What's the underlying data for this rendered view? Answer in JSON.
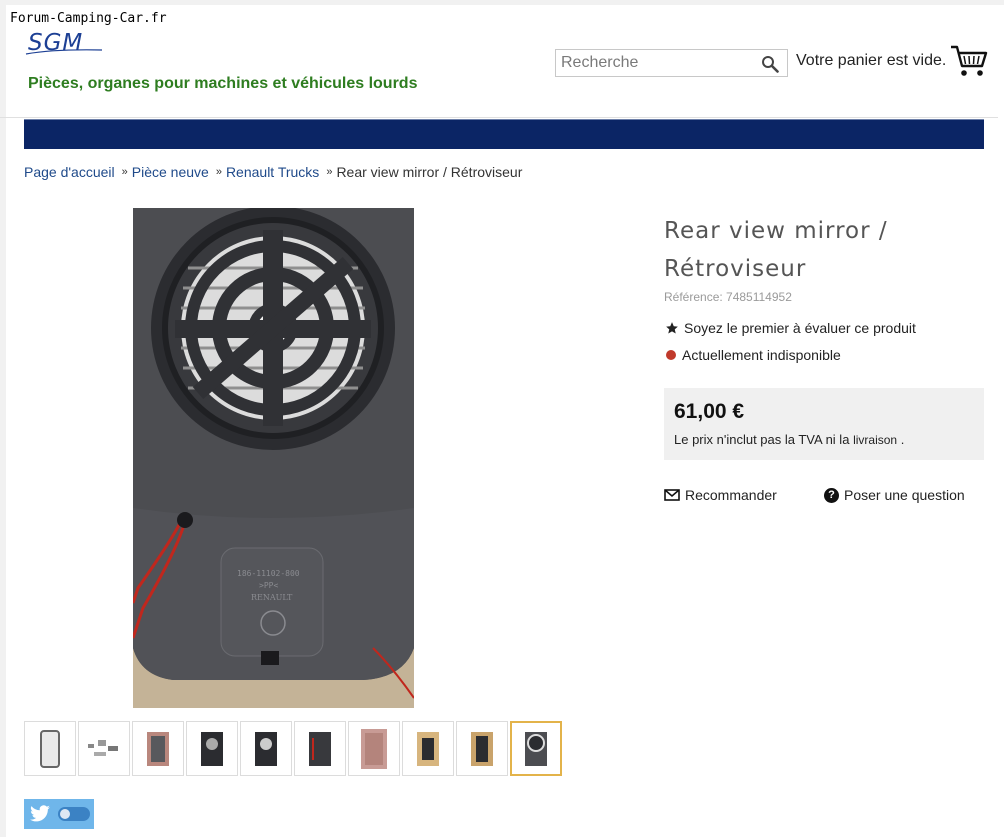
{
  "forum_banner": "Forum-Camping-Car.fr",
  "header": {
    "logo_text": "SGM",
    "tagline": "Pièces, organes pour machines et véhicules lourds",
    "search_placeholder": "Recherche",
    "cart_text": "Votre panier est vide."
  },
  "breadcrumb": {
    "items": [
      "Page d'accueil",
      "Pièce neuve",
      "Renault Trucks",
      "Rear view mirror / Rétroviseur"
    ]
  },
  "product": {
    "title": "Rear view mirror / Rétroviseur",
    "reference": "Référence: 7485114952",
    "rating_text": "Soyez le premier à évaluer ce produit",
    "availability": "Actuellement indisponible",
    "price": "61,00 €",
    "tax_note": "Le prix n'inclut pas la TVA ni la",
    "tax_link": "livraison",
    "tax_end": ".",
    "recommend_label": "Recommander",
    "question_label": "Poser une question",
    "image_marking_line1": "186-11102-800",
    "image_marking_line2": ">PP<",
    "image_marking_line3": "RENAULT"
  },
  "thumbnails": {
    "count": 10,
    "selected_index": 9
  },
  "colors": {
    "nav_bar": "#0b2565",
    "tagline": "#2e7d20",
    "logo": "#1c3f94",
    "selected_thumb_border": "#e3b34a",
    "unavailable_dot": "#c0392b",
    "social_bg": "#6fb6ea"
  },
  "icons": [
    "search-icon",
    "cart-icon",
    "star-icon",
    "envelope-icon",
    "question-icon",
    "twitter-icon",
    "double-chevron-icon"
  ]
}
